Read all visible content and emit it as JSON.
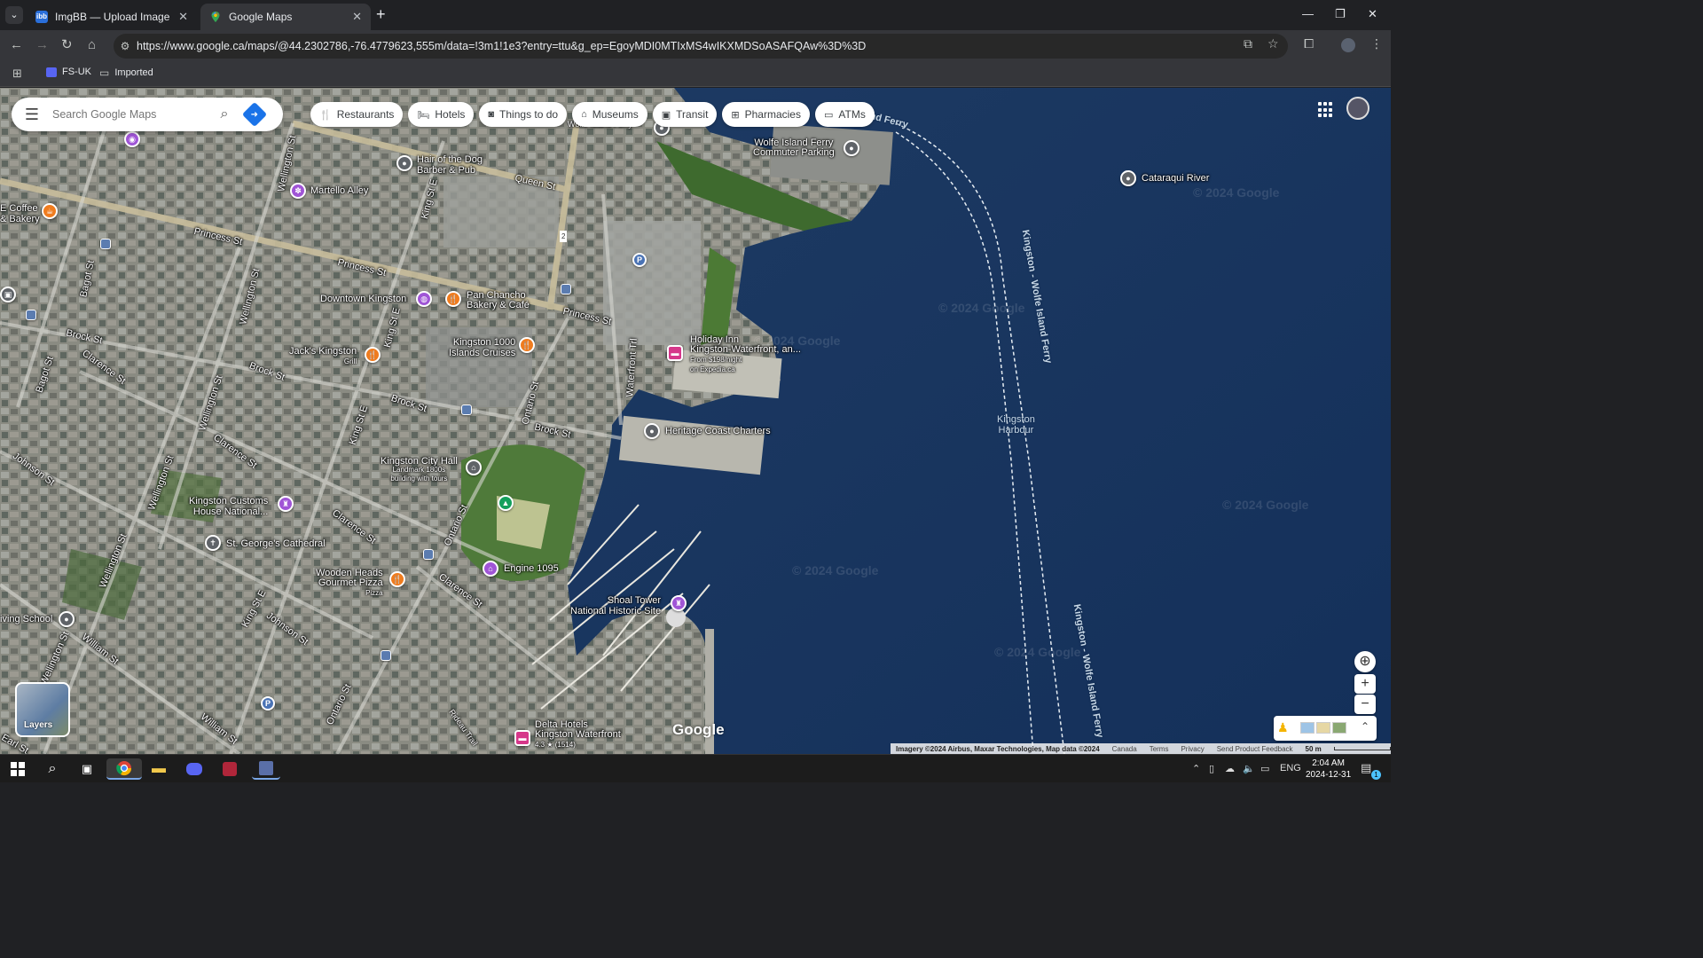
{
  "browser": {
    "tabs": [
      {
        "title": "ImgBB — Upload Image — Free",
        "favicon": "imgbb-icon",
        "active": false
      },
      {
        "title": "Google Maps",
        "favicon": "google-maps-icon",
        "active": true
      }
    ],
    "url": "https://www.google.ca/maps/@44.2302786,-76.4779623,555m/data=!3m1!1e3?entry=ttu&g_ep=EgoyMDI0MTIxMS4wIKXMDSoASAFQAw%3D%3D",
    "bookmarks": [
      "FS-UK",
      "Imported"
    ]
  },
  "maps": {
    "search_placeholder": "Search Google Maps",
    "chips": [
      {
        "label": "Restaurants",
        "icon": "fork-knife-icon"
      },
      {
        "label": "Hotels",
        "icon": "bed-icon"
      },
      {
        "label": "Things to do",
        "icon": "camera-icon"
      },
      {
        "label": "Museums",
        "icon": "museum-icon"
      },
      {
        "label": "Transit",
        "icon": "train-icon"
      },
      {
        "label": "Pharmacies",
        "icon": "pharmacy-icon"
      },
      {
        "label": "ATMs",
        "icon": "atm-icon"
      }
    ],
    "layers_label": "Layers",
    "google_logo": "Google",
    "zoom_in": "+",
    "zoom_out": "−",
    "attribution": {
      "imagery": "Imagery ©2024 Airbus, Maxar Technologies, Map data ©2024",
      "links": [
        "Canada",
        "Terms",
        "Privacy",
        "Send Product Feedback"
      ],
      "scale": "50 m"
    },
    "watermark": "© 2024 Google",
    "places": {
      "hair_of_the_dog": [
        "Hair of the Dog",
        "Barber & Pub"
      ],
      "martello_alley": "Martello Alley",
      "coffee_bakery": [
        "E Coffee",
        "& Bakery"
      ],
      "downtown_kingston": "Downtown Kingston",
      "pan_chancho": [
        "Pan Chancho",
        "Bakery & Café"
      ],
      "kingston_1000": [
        "Kingston 1000",
        "Islands Cruises"
      ],
      "jacks": [
        "Jack's Kingston",
        "Grill"
      ],
      "holiday_inn": [
        "Holiday Inn",
        "Kingston-Waterfront, an...",
        "From $198/night",
        "on Expedia.ca"
      ],
      "heritage_coast": "Heritage Coast Charters",
      "city_hall": [
        "Kingston City Hall",
        "Landmark 1800s",
        "building with tours"
      ],
      "customs_house": [
        "Kingston Customs",
        "House National..."
      ],
      "st_georges": "St. George's Cathedral",
      "engine_1095": "Engine 1095",
      "wooden_heads": [
        "Wooden Heads",
        "Gourmet Pizza",
        "Pizza"
      ],
      "shoal_tower": [
        "Shoal Tower",
        "National Historic Site"
      ],
      "delta_hotels": [
        "Delta Hotels",
        "Kingston Waterfront",
        "4.3 ★ (1514)"
      ],
      "wolfe_parking": [
        "Wolfe Island Ferry",
        "Commuter Parking"
      ],
      "cataraqui": "Cataraqui River",
      "kingston_harbour": [
        "Kingston",
        "Harbour"
      ],
      "driving_school": "iving School",
      "ferry_top": "sland Ferry",
      "ferry_route_1": "Kingston - Wolfe Island Ferry",
      "ferry_route_2": "Kingston - Wolfe Island Ferry",
      "wolfe_ferry_top": "Wolfe Island Ferry"
    },
    "streets": {
      "queen": "Queen St",
      "princess1": "Princess St",
      "princess2": "Princess St",
      "princess3": "Princess St",
      "brock1": "Brock St",
      "brock2": "Brock St",
      "brock3": "Brock St",
      "brock4": "Brock St",
      "clarence1": "Clarence St",
      "clarence2": "Clarence St",
      "clarence3": "Clarence St",
      "clarence4": "Clarence St",
      "johnson1": "Johnson St",
      "johnson2": "Johnson St",
      "william1": "William St",
      "william2": "William St",
      "wellington1": "Wellington St",
      "wellington2": "Wellington St",
      "wellington3": "Wellington St",
      "wellington4": "Wellington St",
      "wellington5": "Wellington St",
      "wellington6": "Wellington St",
      "kinge1": "King St E",
      "kinge2": "King St E",
      "kinge3": "King St E",
      "kinge4": "King St E",
      "ontario1": "Ontario St",
      "ontario2": "Ontario St",
      "ontario3": "Ontario St",
      "bagot1": "Bagot St",
      "bagot2": "Bagot St",
      "waterfront": "Waterfront Trl",
      "rideau": "Rideau Trail",
      "earl": "Earl St",
      "route2": "2"
    }
  },
  "taskbar": {
    "lang": "ENG",
    "time": "2:04 AM",
    "date": "2024-12-31",
    "notification_count": "1"
  }
}
